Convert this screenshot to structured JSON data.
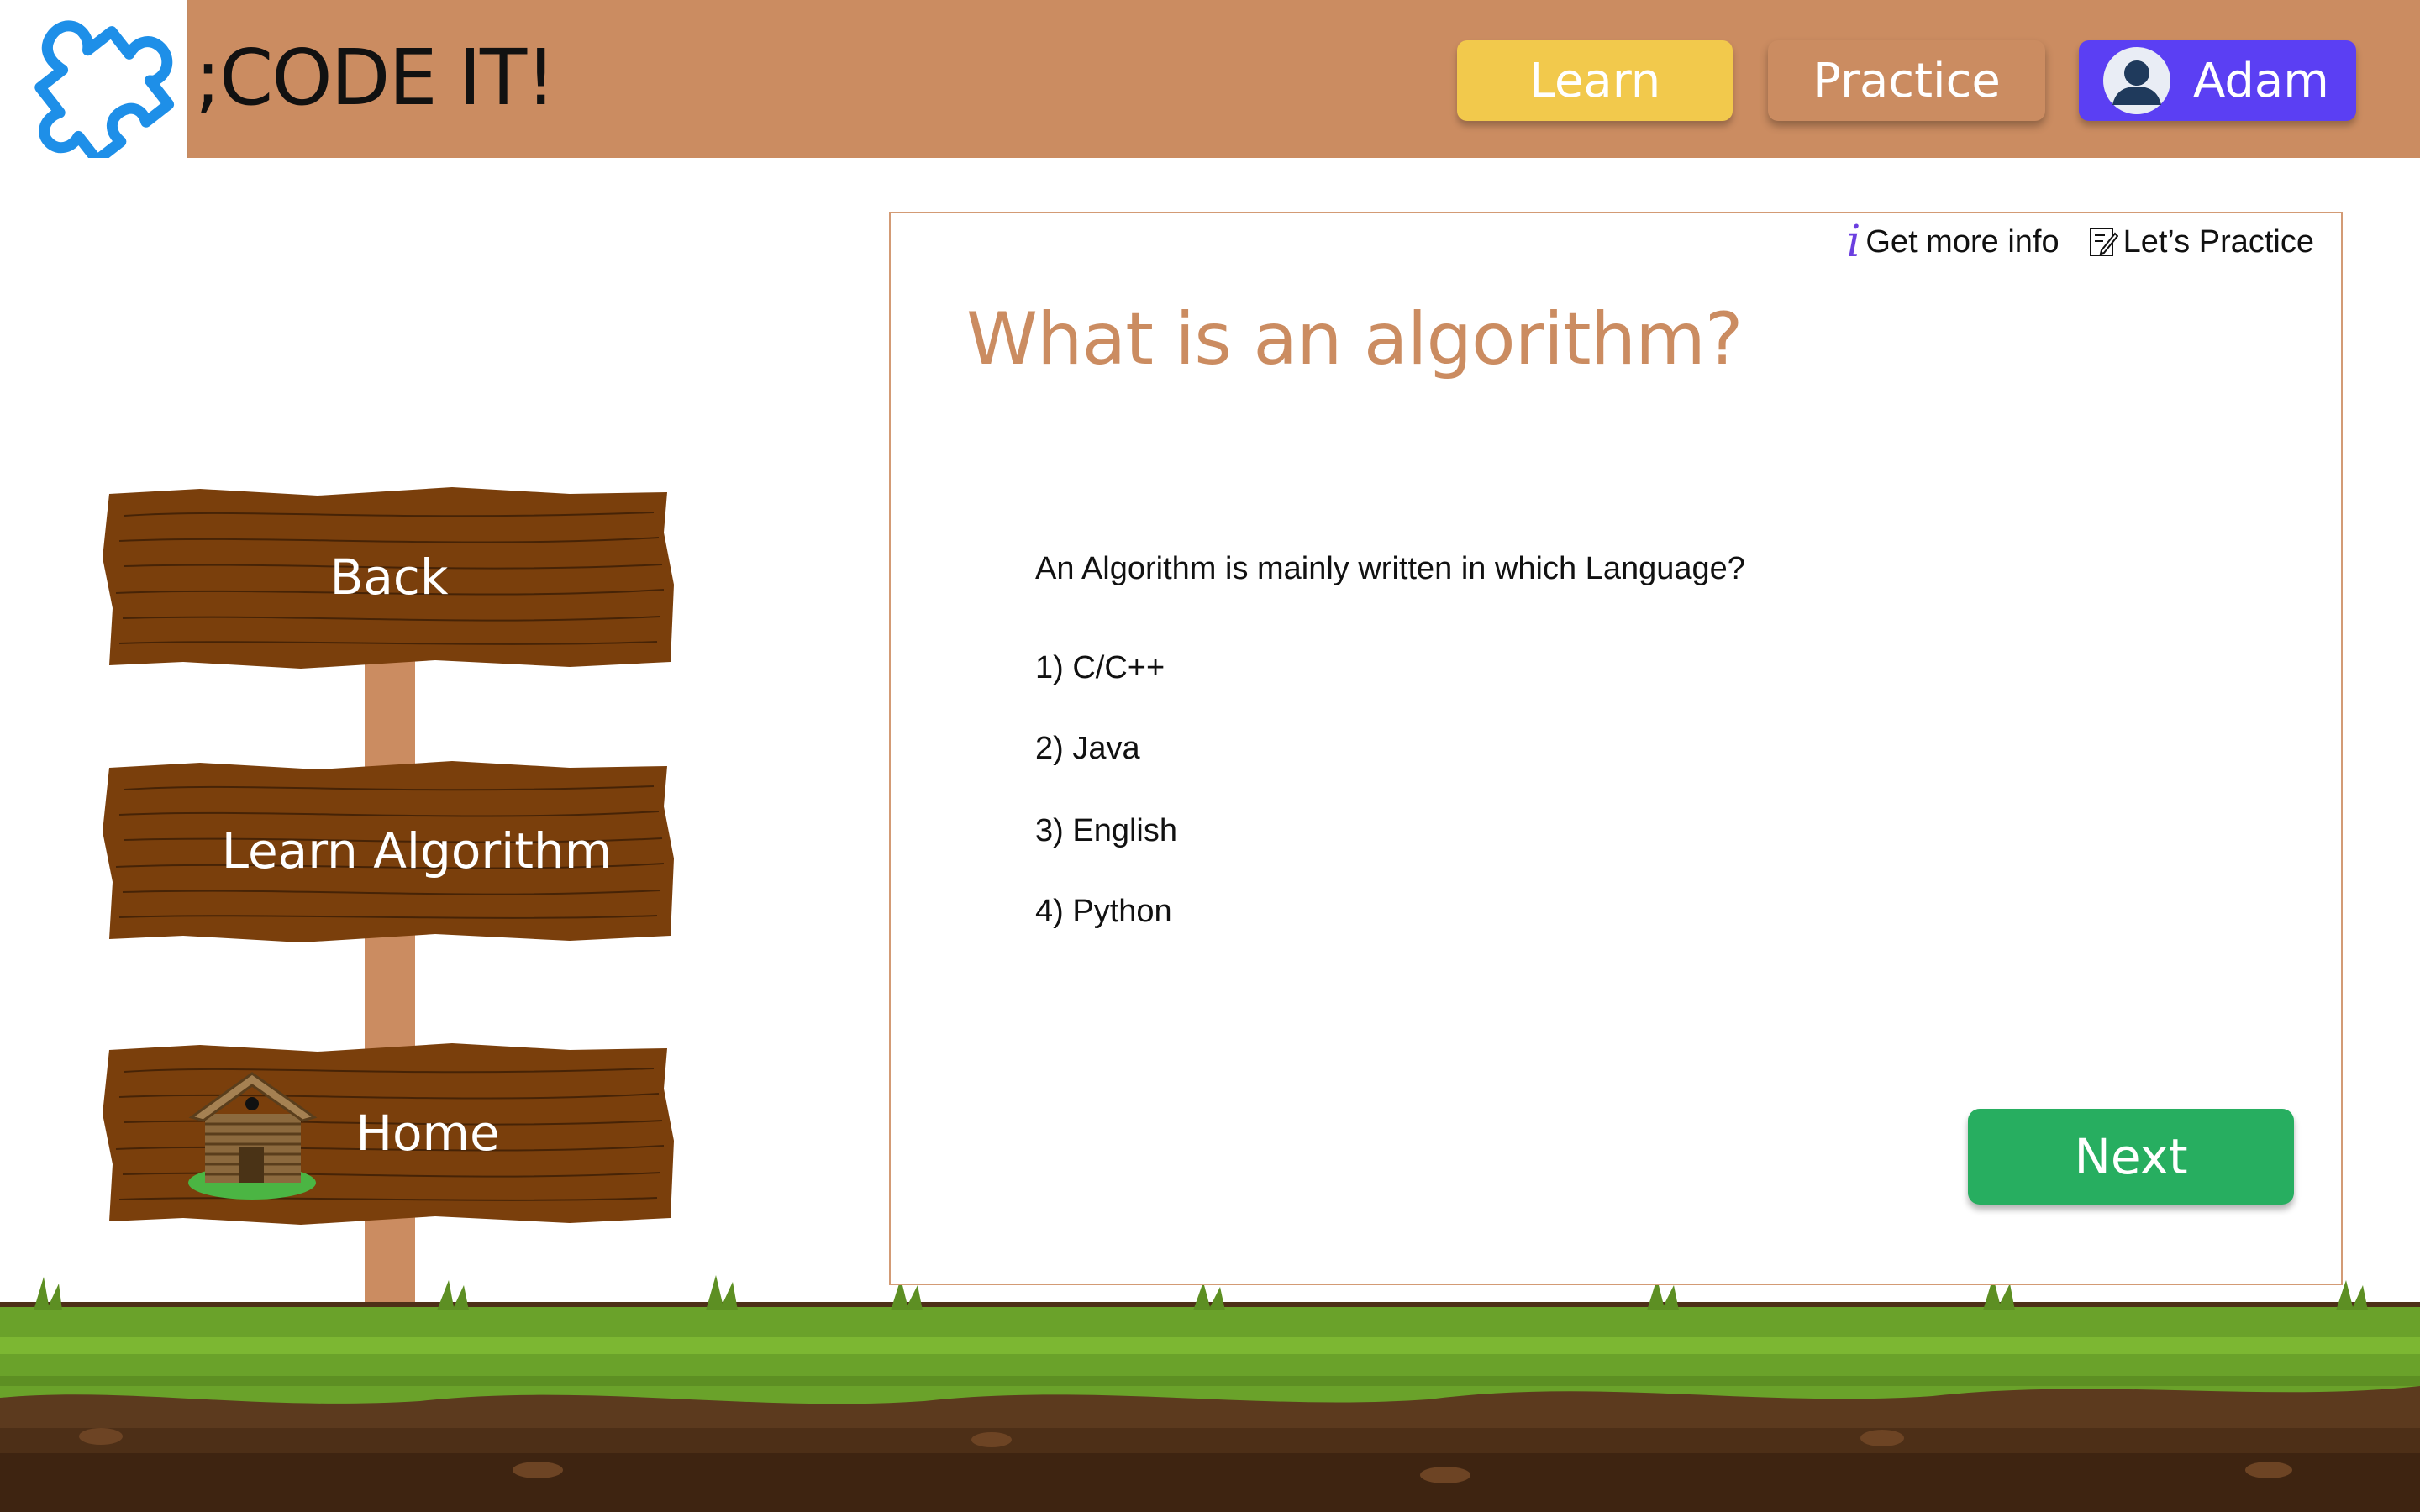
{
  "header": {
    "brand": ";CODE IT!",
    "logo_icon": "puzzle-piece-icon",
    "nav": {
      "learn_label": "Learn",
      "practice_label": "Practice",
      "user_label": "Adam",
      "user_icon": "user-avatar-icon"
    }
  },
  "signpost": {
    "back_label": "Back",
    "learn_algorithm_label": "Learn Algorithm",
    "home_label": "Home",
    "home_icon": "log-cabin-icon"
  },
  "panel": {
    "links": {
      "info_label": "Get more info",
      "info_icon": "info-icon",
      "practice_label": "Let’s Practice",
      "practice_icon": "edit-note-icon"
    },
    "title": "What is an algorithm?",
    "prompt": "An Algorithm is mainly written in which Language?",
    "options": [
      "1) C/C++",
      "2) Java",
      "3) English",
      "4) Python"
    ],
    "next_label": "Next"
  },
  "colors": {
    "header_bg": "#cb8c61",
    "learn_button": "#f2c94c",
    "user_button": "#5b3ff3",
    "next_button": "#27ae60",
    "title_text": "#cb8c61",
    "logo_blue": "#1e8fe8",
    "wood": "#7a3f0c",
    "grass": "#6aa22a"
  }
}
